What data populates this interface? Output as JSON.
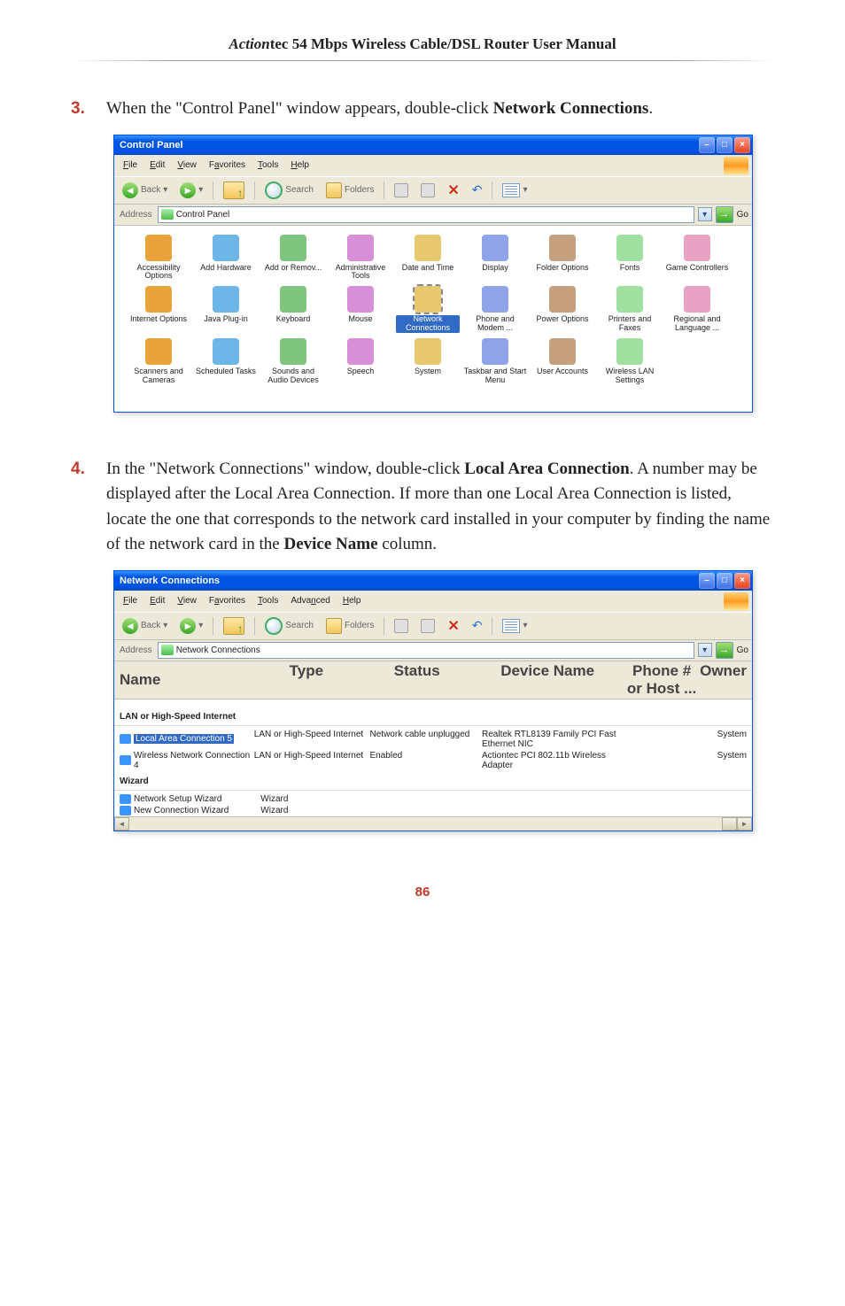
{
  "header": {
    "brand_ital": "Action",
    "brand_rest": "tec 54 Mbps Wireless Cable/DSL Router User Manual"
  },
  "steps": {
    "s3": {
      "num": "3.",
      "text_before": "When the \"Control Panel\" window appears, double-click ",
      "bold": "Network Connections",
      "after": "."
    },
    "s4": {
      "num": "4.",
      "text1": "In the \"Network Connections\" window, double-click ",
      "bold1": "Local Area Connection",
      "text2": ". A number may be displayed after the Local Area Connection. If more than one Local Area Connection is listed, locate the one that corresponds to the network card installed in your computer by finding the name of the network card in the ",
      "bold2": "Device Name",
      "text3": " column."
    }
  },
  "cp_window": {
    "title": "Control Panel",
    "menu": {
      "file": "File",
      "edit": "Edit",
      "view": "View",
      "favorites": "Favorites",
      "tools": "Tools",
      "help": "Help"
    },
    "toolbar": {
      "back": "Back",
      "search": "Search",
      "folders": "Folders"
    },
    "address": {
      "label": "Address",
      "value": "Control Panel",
      "go": "Go"
    },
    "items": [
      {
        "label": "Accessibility Options"
      },
      {
        "label": "Add Hardware"
      },
      {
        "label": "Add or Remov..."
      },
      {
        "label": "Administrative Tools"
      },
      {
        "label": "Date and Time"
      },
      {
        "label": "Display"
      },
      {
        "label": "Folder Options"
      },
      {
        "label": "Fonts"
      },
      {
        "label": "Game Controllers"
      },
      {
        "label": "Internet Options"
      },
      {
        "label": "Java Plug-in"
      },
      {
        "label": "Keyboard"
      },
      {
        "label": "Mouse"
      },
      {
        "label": "Network Connections",
        "selected": true
      },
      {
        "label": "Phone and Modem ..."
      },
      {
        "label": "Power Options"
      },
      {
        "label": "Printers and Faxes"
      },
      {
        "label": "Regional and Language ..."
      },
      {
        "label": "Scanners and Cameras"
      },
      {
        "label": "Scheduled Tasks"
      },
      {
        "label": "Sounds and Audio Devices"
      },
      {
        "label": "Speech"
      },
      {
        "label": "System"
      },
      {
        "label": "Taskbar and Start Menu"
      },
      {
        "label": "User Accounts"
      },
      {
        "label": "Wireless LAN Settings"
      }
    ]
  },
  "nc_window": {
    "title": "Network Connections",
    "menu": {
      "file": "File",
      "edit": "Edit",
      "view": "View",
      "favorites": "Favorites",
      "tools": "Tools",
      "advanced": "Advanced",
      "help": "Help"
    },
    "toolbar": {
      "back": "Back",
      "search": "Search",
      "folders": "Folders"
    },
    "address": {
      "label": "Address",
      "value": "Network Connections",
      "go": "Go"
    },
    "columns": {
      "name": "Name",
      "type": "Type",
      "status": "Status",
      "device": "Device Name",
      "phone": "Phone # or Host ...",
      "owner": "Owner"
    },
    "group1": "LAN or High-Speed Internet",
    "rows1": [
      {
        "name": "Local Area Connection 5",
        "type": "LAN or High-Speed Internet",
        "status": "Network cable unplugged",
        "device": "Realtek RTL8139 Family PCI Fast Ethernet NIC",
        "owner": "System",
        "selected": true
      },
      {
        "name": "Wireless Network Connection 4",
        "type": "LAN or High-Speed Internet",
        "status": "Enabled",
        "device": "Actiontec PCI 802.11b Wireless Adapter",
        "owner": "System"
      }
    ],
    "group2": "Wizard",
    "rows2": [
      {
        "name": "Network Setup Wizard",
        "type": "Wizard"
      },
      {
        "name": "New Connection Wizard",
        "type": "Wizard"
      }
    ]
  },
  "page_number": "86"
}
